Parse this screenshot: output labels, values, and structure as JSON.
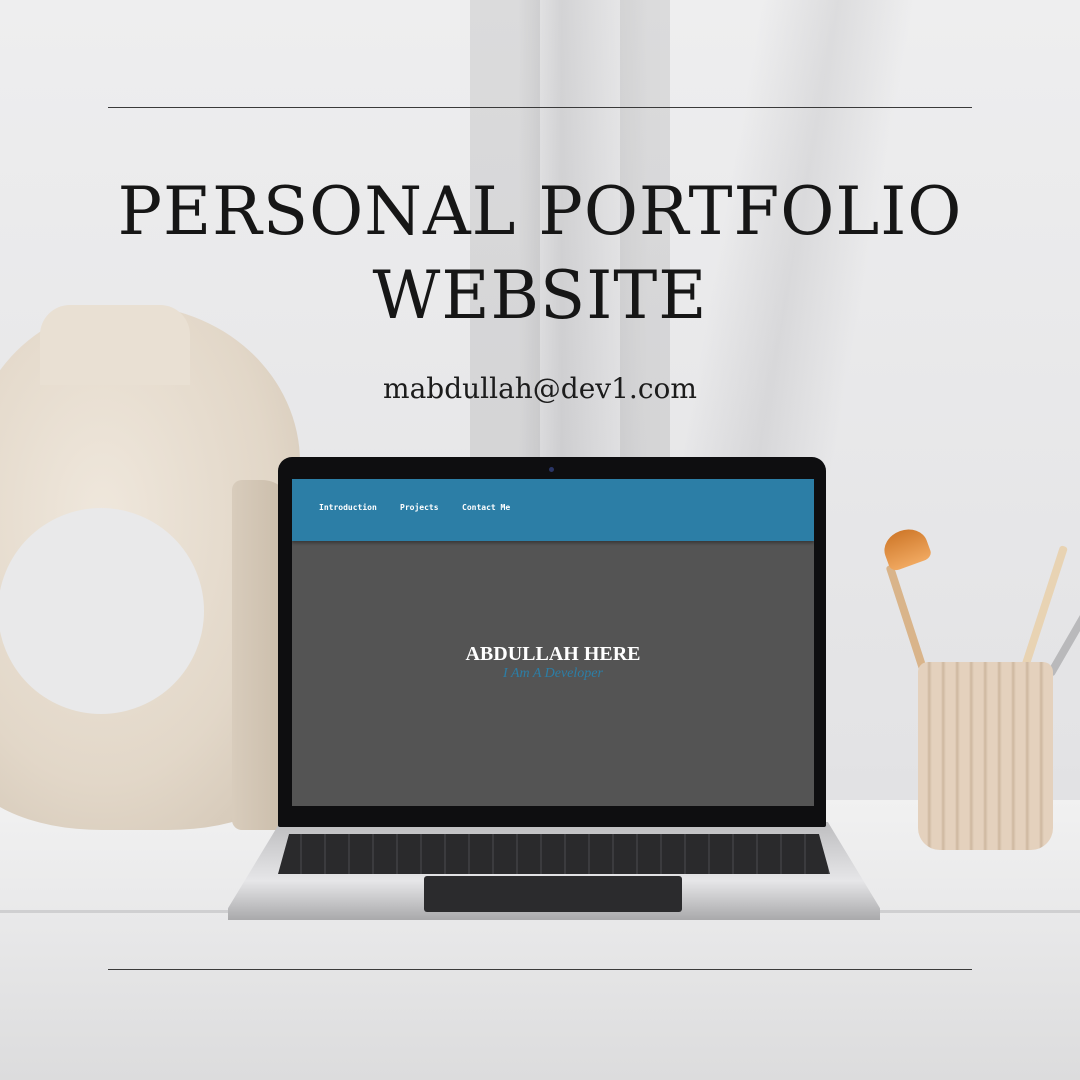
{
  "poster": {
    "title_line1": "PERSONAL PORTFOLIO",
    "title_line2": "WEBSITE",
    "email": "mabdullah@dev1.com"
  },
  "site": {
    "nav": [
      "Introduction",
      "Projects",
      "Contact Me"
    ],
    "hero_name": "ABDULLAH HERE",
    "hero_subtitle": "I Am A Developer",
    "nav_color": "#2c7ea6",
    "body_color": "#545454"
  }
}
